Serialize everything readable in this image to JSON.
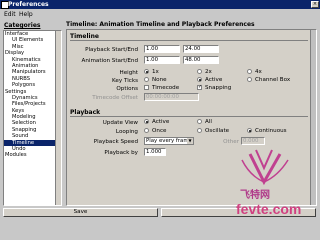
{
  "window": {
    "title": "Preferences"
  },
  "menu": [
    "Edit",
    "Help"
  ],
  "categories": {
    "title": "Categories",
    "items": [
      {
        "label": "Interface",
        "depth": 0
      },
      {
        "label": "UI Elements",
        "depth": 1
      },
      {
        "label": "Misc",
        "depth": 1
      },
      {
        "label": "Display",
        "depth": 0
      },
      {
        "label": "Kinematics",
        "depth": 1
      },
      {
        "label": "Animation",
        "depth": 1
      },
      {
        "label": "Manipulators",
        "depth": 1
      },
      {
        "label": "NURBS",
        "depth": 1
      },
      {
        "label": "Polygons",
        "depth": 1
      },
      {
        "label": "Settings",
        "depth": 0
      },
      {
        "label": "Dynamics",
        "depth": 1
      },
      {
        "label": "Files/Projects",
        "depth": 1
      },
      {
        "label": "Keys",
        "depth": 1
      },
      {
        "label": "Modeling",
        "depth": 1
      },
      {
        "label": "Selection",
        "depth": 1
      },
      {
        "label": "Snapping",
        "depth": 1
      },
      {
        "label": "Sound",
        "depth": 1
      },
      {
        "label": "Timeline",
        "depth": 1,
        "selected": true
      },
      {
        "label": "Undo",
        "depth": 1
      },
      {
        "label": "Modules",
        "depth": 0
      }
    ]
  },
  "page": {
    "title": "Timeline: Animation Timeline and Playback Preferences",
    "timeline": {
      "heading": "Timeline",
      "playback_label": "Playback Start/End",
      "playback_start": "1.00",
      "playback_end": "24.00",
      "animation_label": "Animation Start/End",
      "animation_start": "1.00",
      "animation_end": "48.00",
      "height_label": "Height",
      "height_options": [
        "1x",
        "2x",
        "4x"
      ],
      "keyticks_label": "Key Ticks",
      "keyticks_options": [
        "None",
        "Active",
        "Channel Box"
      ],
      "options_label": "Options",
      "option_timecode": "Timecode",
      "option_snapping": "Snapping",
      "timecode_offset_label": "Timecode Offset",
      "timecode_offset_value": "00:00:00:00"
    },
    "playback": {
      "heading": "Playback",
      "update_view_label": "Update View",
      "update_view_options": [
        "Active",
        "All"
      ],
      "looping_label": "Looping",
      "looping_options": [
        "Once",
        "Oscillate",
        "Continuous"
      ],
      "speed_label": "Playback Speed",
      "speed_value": "Play every frame",
      "other_label": "Other",
      "other_value": "0.000",
      "playby_label": "Playback by",
      "playby_value": "1.000"
    }
  },
  "footer": {
    "save_label": "Save"
  },
  "watermark": {
    "cn_text": "飞特网",
    "en_text": "fevte.com"
  },
  "colors": {
    "titlebar": "#0a246a",
    "window_bg": "#d4d0c8",
    "watermark": "#c04090"
  }
}
